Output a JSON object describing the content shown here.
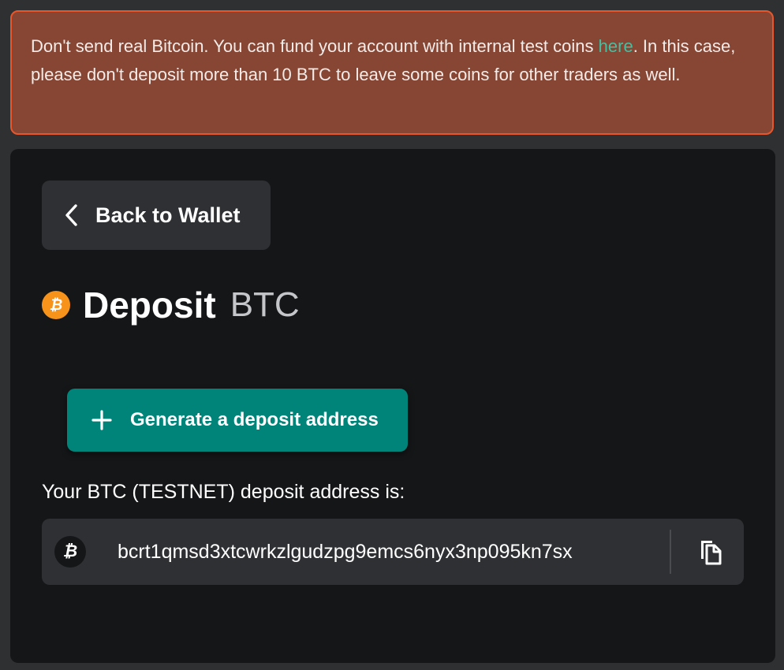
{
  "warning": {
    "text_before": "Don't send real Bitcoin. You can fund your account with internal test coins ",
    "link_text": "here",
    "text_after": ". In this case, please don't deposit more than 10 BTC to leave some coins for other traders as well."
  },
  "back_button": {
    "label": "Back to Wallet",
    "icon": "chevron-left-icon"
  },
  "title": {
    "main": "Deposit",
    "currency": "BTC",
    "icon": "bitcoin-icon"
  },
  "generate_button": {
    "label": "Generate a deposit address",
    "icon": "plus-icon"
  },
  "address": {
    "caption": "Your BTC (TESTNET) deposit address is:",
    "value": "bcrt1qmsd3xtcwrkzlgudzpg9emcs6nyx3np095kn7sx",
    "copy_icon": "copy-icon"
  },
  "colors": {
    "warning_bg": "#874533",
    "warning_border": "#e8572c",
    "link": "#3fc1a3",
    "accent": "#00847a",
    "bitcoin": "#f7931a",
    "panel_bg": "#151618"
  }
}
